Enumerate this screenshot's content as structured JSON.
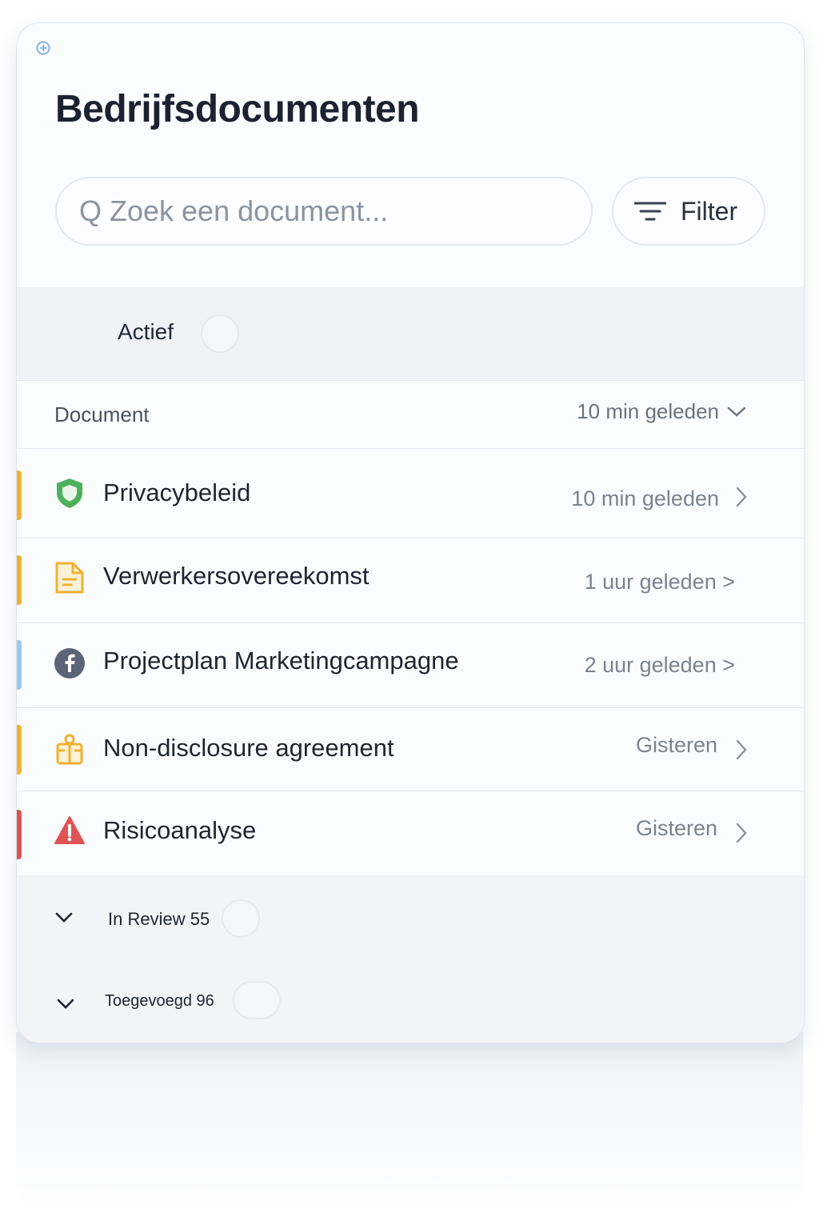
{
  "header": {
    "title": "Bedrijfsdocumenten"
  },
  "search": {
    "placeholder": "Q Zoek een document..."
  },
  "filter": {
    "label": "Filter"
  },
  "section_active": {
    "label": "Actief"
  },
  "table_header": {
    "document": "Document",
    "sort_value": "10 min geleden"
  },
  "documents": [
    {
      "title": "Privacybeleid",
      "time": "10 min geleden",
      "icon": "shield-icon",
      "stripe": "#f0b132"
    },
    {
      "title": "Verwerkersovereekomst",
      "time": "1 uur geleden >",
      "icon": "document-icon",
      "stripe": "#f0b132"
    },
    {
      "title": "Projectplan Marketingcampagne",
      "time": "2 uur geleden >",
      "icon": "facebook-icon",
      "stripe": "#9cc7ef"
    },
    {
      "title": "Non-disclosure agreement",
      "time": "Gisteren",
      "icon": "gift-icon",
      "stripe": "#f0b132"
    },
    {
      "title": "Risicoanalyse",
      "time": "Gisteren",
      "icon": "warning-icon",
      "stripe": "#e05353"
    }
  ],
  "groups": [
    {
      "label": "In Review 55"
    },
    {
      "label": "Toegevoegd 96"
    }
  ],
  "colors": {
    "accent_blue": "#5aa7e8",
    "shield_green": "#4cb15c",
    "doc_yellow": "#f0b132",
    "warning_red": "#e05353",
    "facebook_gray": "#5b6577"
  }
}
